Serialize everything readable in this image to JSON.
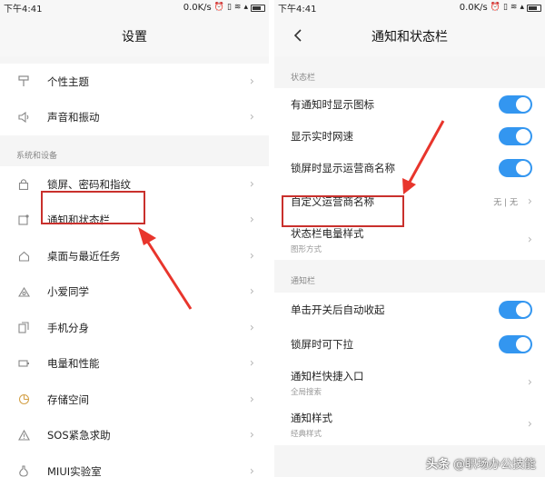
{
  "status_bar": {
    "time": "下午4:41",
    "speed": "0.0K/s",
    "icons": [
      "alarm-icon",
      "vibrate-icon",
      "wifi-icon",
      "signal-icon",
      "battery-icon"
    ]
  },
  "left": {
    "title": "设置",
    "group1": [
      {
        "label": "个性主题",
        "icon": "paint-roller-icon"
      },
      {
        "label": "声音和振动",
        "icon": "speaker-icon"
      }
    ],
    "section_label": "系统和设备",
    "group2": [
      {
        "label": "锁屏、密码和指纹",
        "icon": "lock-icon"
      },
      {
        "label": "通知和状态栏",
        "icon": "notification-icon"
      },
      {
        "label": "桌面与最近任务",
        "icon": "home-icon"
      },
      {
        "label": "小爱同学",
        "icon": "assistant-icon"
      },
      {
        "label": "手机分身",
        "icon": "dual-phone-icon"
      },
      {
        "label": "电量和性能",
        "icon": "battery-outline-icon"
      },
      {
        "label": "存储空间",
        "icon": "storage-pie-icon"
      },
      {
        "label": "SOS紧急求助",
        "icon": "sos-icon"
      },
      {
        "label": "MIUI实验室",
        "icon": "flask-icon"
      }
    ]
  },
  "right": {
    "title": "通知和状态栏",
    "section1_label": "状态栏",
    "status_rows": [
      {
        "label": "有通知时显示图标",
        "toggle": true
      },
      {
        "label": "显示实时网速",
        "toggle": true
      },
      {
        "label": "锁屏时显示运营商名称",
        "toggle": true
      }
    ],
    "carrier_row": {
      "label": "自定义运营商名称",
      "value": "无 | 无"
    },
    "battery_style": {
      "label": "状态栏电量样式",
      "sub": "图形方式"
    },
    "section2_label": "通知栏",
    "notif_rows": [
      {
        "label": "单击开关后自动收起",
        "toggle": true
      },
      {
        "label": "锁屏时可下拉",
        "toggle": true
      }
    ],
    "shortcut": {
      "label": "通知栏快捷入口",
      "sub": "全局搜索"
    },
    "notif_style": {
      "label": "通知样式",
      "sub": "经典样式"
    }
  },
  "watermark": {
    "logo": "头条",
    "text": "@职场办公技能"
  },
  "colors": {
    "accent": "#3396f0",
    "highlight": "#c9302c",
    "background": "#f5f5f5"
  }
}
